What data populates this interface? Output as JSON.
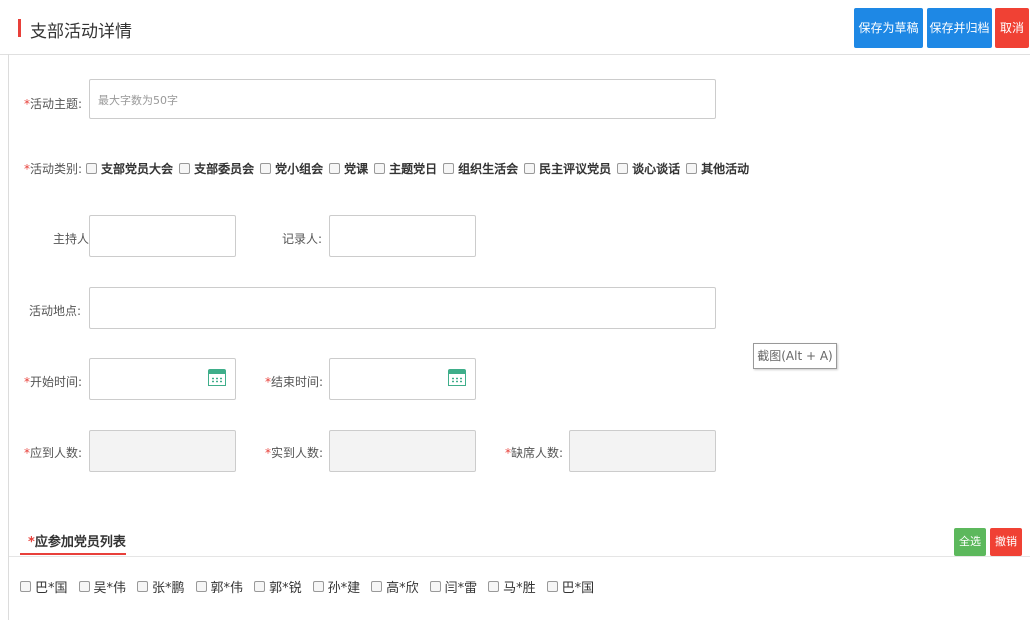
{
  "header": {
    "title": "支部活动详情",
    "save_draft_label": "保存为草稿",
    "save_archive_label": "保存并归档",
    "cancel_label": "取消"
  },
  "form": {
    "topic": {
      "required_mark": "*",
      "label": "活动主题:",
      "placeholder": "最大字数为50字",
      "value": ""
    },
    "category": {
      "required_mark": "*",
      "label": "活动类别:",
      "options": [
        "支部党员大会",
        "支部委员会",
        "党小组会",
        "党课",
        "主题党日",
        "组织生活会",
        "民主评议党员",
        "谈心谈话",
        "其他活动"
      ]
    },
    "host": {
      "label": "主持人:",
      "value": ""
    },
    "recorder": {
      "label": "记录人:",
      "value": ""
    },
    "location": {
      "label": "活动地点:",
      "value": ""
    },
    "start_time": {
      "required_mark": "*",
      "label": "开始时间:",
      "value": ""
    },
    "end_time": {
      "required_mark": "*",
      "label": "结束时间:",
      "value": ""
    },
    "expected_count": {
      "required_mark": "*",
      "label": "应到人数:",
      "value": ""
    },
    "actual_count": {
      "required_mark": "*",
      "label": "实到人数:",
      "value": ""
    },
    "absent_count": {
      "required_mark": "*",
      "label": "缺席人数:",
      "value": ""
    }
  },
  "tooltip": {
    "text": "截图(Alt + A)"
  },
  "members_section": {
    "required_mark": "*",
    "title": "应参加党员列表",
    "select_all_label": "全选",
    "undo_label": "撤销",
    "members": [
      "巴*国",
      "吴*伟",
      "张*鹏",
      "郭*伟",
      "郭*锐",
      "孙*建",
      "高*欣",
      "闫*雷",
      "马*胜",
      "巴*国"
    ]
  },
  "colors": {
    "accent_red": "#e8403a",
    "primary_blue": "#1e88e5",
    "success_green": "#5cb85c",
    "calendar_green": "#3fae8a"
  },
  "icons": {
    "calendar": "calendar-icon",
    "checkbox": "checkbox-icon"
  }
}
